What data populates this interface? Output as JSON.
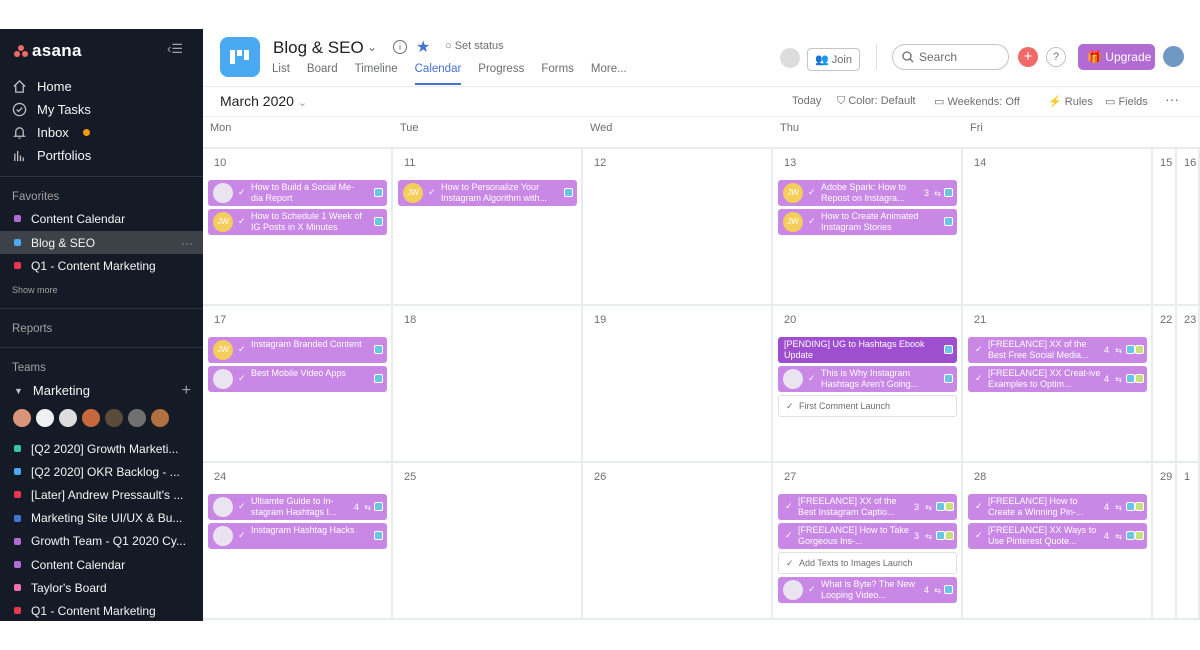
{
  "sidebar": {
    "brand": "asana",
    "nav": [
      {
        "label": "Home",
        "icon": "home-icon"
      },
      {
        "label": "My Tasks",
        "icon": "check-circle-icon"
      },
      {
        "label": "Inbox",
        "icon": "bell-icon"
      },
      {
        "label": "Portfolios",
        "icon": "bar-chart-icon"
      }
    ],
    "favorites_label": "Favorites",
    "favorites": [
      {
        "label": "Content Calendar",
        "color": "#b36bd4"
      },
      {
        "label": "Blog & SEO",
        "color": "#4aa9f0"
      },
      {
        "label": "Q1 - Content Marketing",
        "color": "#e8384f"
      }
    ],
    "show_more": "Show more",
    "reports_label": "Reports",
    "teams_label": "Teams",
    "team_name": "Marketing",
    "team_projects": [
      {
        "label": "[Q2 2020] Growth Marketi...",
        "color": "#37c5ab"
      },
      {
        "label": "[Q2 2020] OKR Backlog - ...",
        "color": "#4aa9f0"
      },
      {
        "label": "[Later] Andrew Pressault's ...",
        "color": "#e8384f"
      },
      {
        "label": "Marketing Site UI/UX & Bu...",
        "color": "#4573d2"
      },
      {
        "label": "Growth Team - Q1 2020 Cy...",
        "color": "#b36bd4"
      },
      {
        "label": "Content Calendar",
        "color": "#b36bd4"
      },
      {
        "label": "Taylor's Board",
        "color": "#f26fb2"
      },
      {
        "label": "Q1 - Content Marketing",
        "color": "#e8384f"
      }
    ]
  },
  "header": {
    "project_title": "Blog & SEO",
    "set_status": "Set status",
    "tabs": [
      "List",
      "Board",
      "Timeline",
      "Calendar",
      "Progress",
      "Forms",
      "More..."
    ],
    "active_tab": "Calendar",
    "join_label": "Join",
    "search_placeholder": "Search",
    "help": "?",
    "upgrade_label": "Upgrade"
  },
  "toolbar": {
    "month": "March 2020",
    "today": "Today",
    "color": "Color: Default",
    "weekends": "Weekends: Off",
    "rules": "Rules",
    "fields": "Fields"
  },
  "days": [
    "Mon",
    "Tue",
    "Wed",
    "Thu",
    "Fri"
  ],
  "weeks": [
    {
      "dates": [
        "10",
        "11",
        "12",
        "13",
        "14",
        "15",
        "16"
      ],
      "tasks": [
        [
          {
            "text": "How to Build a Social Me-dia Report",
            "avatar": "photo"
          },
          {
            "text": "How to Schedule 1 Week of IG Posts in X Minutes",
            "avatar": "JW"
          }
        ],
        [
          {
            "text": "How to Personalize Your Instagram Algorithm with...",
            "avatar": "JW"
          }
        ],
        [],
        [
          {
            "text": "Adobe Spark: How to Repost on Instagra...",
            "avatar": "JW",
            "count": "3"
          },
          {
            "text": "How to Create Animated Instagram Stories",
            "avatar": "JW"
          }
        ],
        []
      ]
    },
    {
      "dates": [
        "17",
        "18",
        "19",
        "20",
        "21",
        "22",
        "23"
      ],
      "tasks": [
        [
          {
            "text": "Instagram Branded Content",
            "avatar": "JW"
          },
          {
            "text": "Best Mobile Video Apps",
            "avatar": "photo"
          }
        ],
        [],
        [],
        [
          {
            "text": "[PENDING] UG to Hashtags Ebook Update",
            "style": "dark"
          },
          {
            "text": "This is Why Instagram Hashtags Aren't Going...",
            "avatar": "photo"
          },
          {
            "text": "First Comment Launch",
            "style": "plain"
          }
        ],
        [
          {
            "text": "[FREELANCE] XX of the Best Free Social Media...",
            "count": "4"
          },
          {
            "text": "[FREELANCE] XX Creat-ive Examples to Optim...",
            "count": "4"
          }
        ]
      ]
    },
    {
      "dates": [
        "24",
        "25",
        "26",
        "27",
        "28",
        "29",
        "1"
      ],
      "tasks": [
        [
          {
            "text": "Ultiamte Guide to In-stagram Hashtags I...",
            "avatar": "photo",
            "count": "4"
          },
          {
            "text": "Instagram Hashtag Hacks",
            "avatar": "photo"
          }
        ],
        [],
        [],
        [
          {
            "text": "[FREELANCE] XX of the Best Instagram Captio...",
            "count": "3"
          },
          {
            "text": "[FREELANCE] How to Take Gorgeous Ins-...",
            "count": "3"
          },
          {
            "text": "Add Texts to Images Launch",
            "style": "plain"
          },
          {
            "text": "What is Byte? The New Looping Video...",
            "avatar": "photo",
            "count": "4"
          }
        ],
        [
          {
            "text": "[FREELANCE] How to Create a Winning Pin-...",
            "count": "4"
          },
          {
            "text": "[FREELANCE] XX Ways to Use Pinterest Quote...",
            "count": "4"
          }
        ]
      ]
    }
  ]
}
